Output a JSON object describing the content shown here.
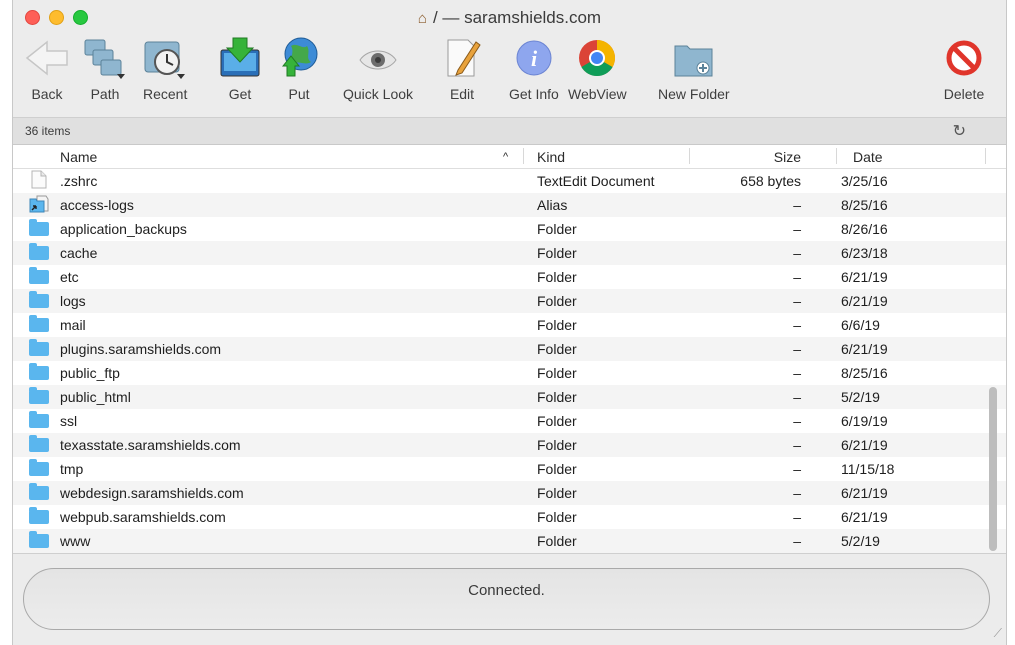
{
  "window": {
    "title": "/ — saramshields.com"
  },
  "toolbar": {
    "back": "Back",
    "path": "Path",
    "recent": "Recent",
    "get": "Get",
    "put": "Put",
    "quick_look": "Quick Look",
    "edit": "Edit",
    "get_info": "Get Info",
    "webview": "WebView",
    "new_folder": "New Folder",
    "delete": "Delete"
  },
  "status": {
    "items_count": "36 items",
    "connection": "Connected."
  },
  "columns": {
    "name": "Name",
    "kind": "Kind",
    "size": "Size",
    "date": "Date"
  },
  "files": [
    {
      "name": ".zshrc",
      "kind": "TextEdit Document",
      "size": "658 bytes",
      "date": "3/25/16",
      "icon": "document-icon"
    },
    {
      "name": "access-logs",
      "kind": "Alias",
      "size": "–",
      "date": "8/25/16",
      "icon": "alias-icon"
    },
    {
      "name": "application_backups",
      "kind": "Folder",
      "size": "–",
      "date": "8/26/16",
      "icon": "folder-icon"
    },
    {
      "name": "cache",
      "kind": "Folder",
      "size": "–",
      "date": "6/23/18",
      "icon": "folder-icon"
    },
    {
      "name": "etc",
      "kind": "Folder",
      "size": "–",
      "date": "6/21/19",
      "icon": "folder-icon"
    },
    {
      "name": "logs",
      "kind": "Folder",
      "size": "–",
      "date": "6/21/19",
      "icon": "folder-icon"
    },
    {
      "name": "mail",
      "kind": "Folder",
      "size": "–",
      "date": "6/6/19",
      "icon": "folder-icon"
    },
    {
      "name": "plugins.saramshields.com",
      "kind": "Folder",
      "size": "–",
      "date": "6/21/19",
      "icon": "folder-icon"
    },
    {
      "name": "public_ftp",
      "kind": "Folder",
      "size": "–",
      "date": "8/25/16",
      "icon": "folder-icon"
    },
    {
      "name": "public_html",
      "kind": "Folder",
      "size": "–",
      "date": "5/2/19",
      "icon": "folder-icon"
    },
    {
      "name": "ssl",
      "kind": "Folder",
      "size": "–",
      "date": "6/19/19",
      "icon": "folder-icon"
    },
    {
      "name": "texasstate.saramshields.com",
      "kind": "Folder",
      "size": "–",
      "date": "6/21/19",
      "icon": "folder-icon"
    },
    {
      "name": "tmp",
      "kind": "Folder",
      "size": "–",
      "date": "11/15/18",
      "icon": "folder-icon"
    },
    {
      "name": "webdesign.saramshields.com",
      "kind": "Folder",
      "size": "–",
      "date": "6/21/19",
      "icon": "folder-icon"
    },
    {
      "name": "webpub.saramshields.com",
      "kind": "Folder",
      "size": "–",
      "date": "6/21/19",
      "icon": "folder-icon"
    },
    {
      "name": "www",
      "kind": "Folder",
      "size": "–",
      "date": "5/2/19",
      "icon": "folder-icon"
    }
  ],
  "colors": {
    "folder": "#5ab6ee",
    "close": "#fe5f57",
    "minimize": "#febc2e",
    "maximize": "#28c840",
    "delete": "#e0352b"
  }
}
